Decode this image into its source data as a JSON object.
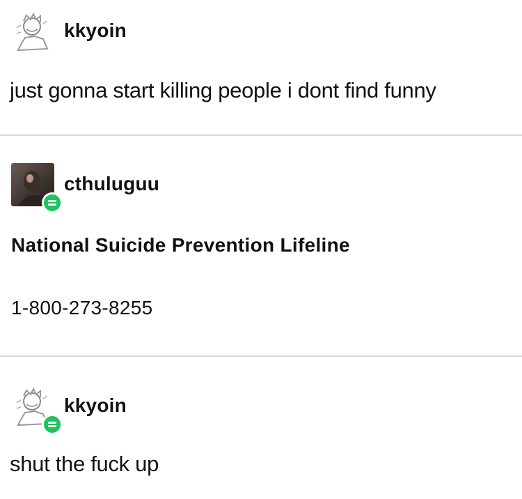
{
  "posts": [
    {
      "username": "kkyoin",
      "avatar_icon": "sketch-avatar-icon",
      "reblog": false,
      "body": "just gonna start killing people i dont find funny"
    },
    {
      "username": "cthuluguu",
      "avatar_icon": "photo-avatar-icon",
      "reblog": true,
      "title": "National Suicide Prevention Lifeline",
      "body": "1-800-273-8255"
    },
    {
      "username": "kkyoin",
      "avatar_icon": "sketch-avatar-icon",
      "reblog": true,
      "body": "shut the fuck up"
    }
  ],
  "colors": {
    "reblog_badge": "#1fc45a",
    "divider": "#dadada",
    "text": "#111111"
  }
}
